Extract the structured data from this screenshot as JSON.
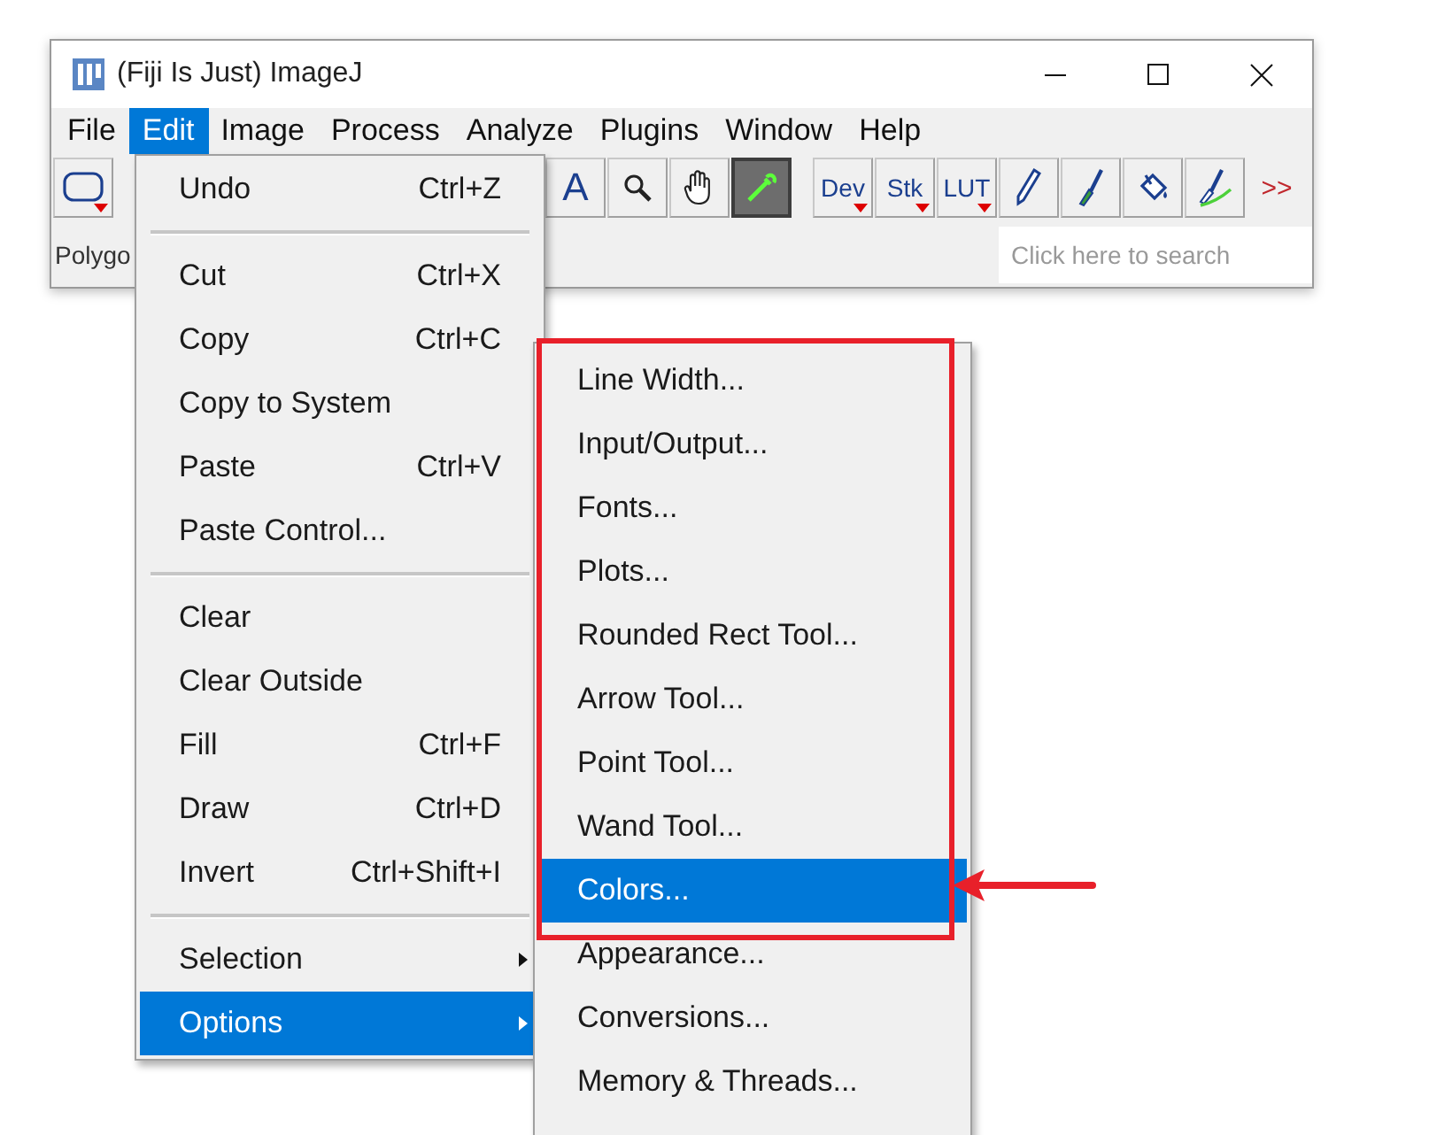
{
  "window": {
    "title": "(Fiji Is Just) ImageJ"
  },
  "menubar": [
    {
      "label": "File",
      "selected": false
    },
    {
      "label": "Edit",
      "selected": true
    },
    {
      "label": "Image",
      "selected": false
    },
    {
      "label": "Process",
      "selected": false
    },
    {
      "label": "Analyze",
      "selected": false
    },
    {
      "label": "Plugins",
      "selected": false
    },
    {
      "label": "Window",
      "selected": false
    },
    {
      "label": "Help",
      "selected": false
    }
  ],
  "toolbar": [
    {
      "kind": "icon",
      "selected": false
    },
    {
      "kind": "gap"
    },
    {
      "kind": "text",
      "label": "A",
      "selected": false
    },
    {
      "kind": "icon",
      "selected": false
    },
    {
      "kind": "icon",
      "selected": false
    },
    {
      "kind": "icon",
      "selected": true
    },
    {
      "kind": "gap"
    },
    {
      "kind": "menu",
      "label": "Dev"
    },
    {
      "kind": "menu",
      "label": "Stk"
    },
    {
      "kind": "menu",
      "label": "LUT"
    },
    {
      "kind": "icon",
      "selected": false
    },
    {
      "kind": "icon",
      "selected": false
    },
    {
      "kind": "icon",
      "selected": false
    },
    {
      "kind": "icon",
      "selected": false
    },
    {
      "kind": "more",
      "label": ">>"
    }
  ],
  "status": {
    "text": "Polygo"
  },
  "search": {
    "placeholder": "Click here to search"
  },
  "edit_menu": [
    {
      "kind": "item",
      "label": "Undo",
      "shortcut": "Ctrl+Z",
      "selected": false
    },
    {
      "kind": "separator"
    },
    {
      "kind": "item",
      "label": "Cut",
      "shortcut": "Ctrl+X",
      "selected": false
    },
    {
      "kind": "item",
      "label": "Copy",
      "shortcut": "Ctrl+C",
      "selected": false
    },
    {
      "kind": "item",
      "label": "Copy to System",
      "selected": false
    },
    {
      "kind": "item",
      "label": "Paste",
      "shortcut": "Ctrl+V",
      "selected": false
    },
    {
      "kind": "item",
      "label": "Paste Control...",
      "selected": false
    },
    {
      "kind": "separator"
    },
    {
      "kind": "item",
      "label": "Clear",
      "selected": false
    },
    {
      "kind": "item",
      "label": "Clear Outside",
      "selected": false
    },
    {
      "kind": "item",
      "label": "Fill",
      "shortcut": "Ctrl+F",
      "selected": false
    },
    {
      "kind": "item",
      "label": "Draw",
      "shortcut": "Ctrl+D",
      "selected": false
    },
    {
      "kind": "item",
      "label": "Invert",
      "shortcut": "Ctrl+Shift+I",
      "selected": false
    },
    {
      "kind": "separator"
    },
    {
      "kind": "submenu",
      "label": "Selection",
      "selected": false
    },
    {
      "kind": "submenu",
      "label": "Options",
      "selected": true
    }
  ],
  "options_menu": [
    {
      "label": "Line Width...",
      "selected": false
    },
    {
      "label": "Input/Output...",
      "selected": false
    },
    {
      "label": "Fonts...",
      "selected": false
    },
    {
      "label": "Plots...",
      "selected": false
    },
    {
      "label": "Rounded Rect Tool...",
      "selected": false
    },
    {
      "label": "Arrow Tool...",
      "selected": false
    },
    {
      "label": "Point Tool...",
      "selected": false
    },
    {
      "label": "Wand Tool...",
      "selected": false
    },
    {
      "label": "Colors...",
      "selected": true
    },
    {
      "label": "Appearance...",
      "selected": false
    },
    {
      "label": "Conversions...",
      "selected": false
    },
    {
      "label": "Memory & Threads...",
      "selected": false
    }
  ],
  "annotation": {
    "kind": "box_with_arrow"
  }
}
